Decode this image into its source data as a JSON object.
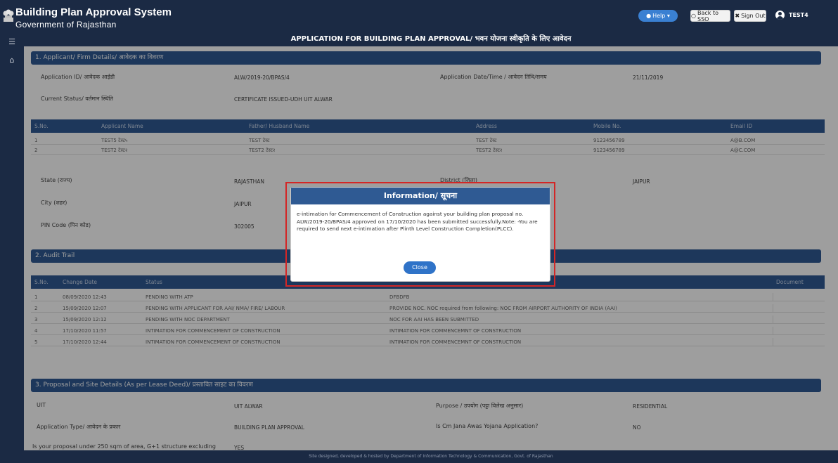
{
  "header": {
    "app_title": "Building Plan Approval System",
    "subtitle": "Government of Rajasthan",
    "help_label": "Help ▾",
    "back_sso_label": "Back to SSO",
    "sign_out_label": "Sign Out",
    "user_name": "TEST4"
  },
  "page_title": "APPLICATION FOR BUILDING PLAN APPROVAL/ भवन योजना स्वीकृति के लिए आवेदन",
  "section1": {
    "title": "1. Applicant/ Firm Details/ आवेदक का विवरण",
    "app_id_label": "Application ID/ आवेदक आईडी",
    "app_id_value": "ALW/2019-20/BPAS/4",
    "app_date_label": "Application Date/Time / आवेदन तिथि/समय",
    "app_date_value": "21/11/2019",
    "status_label": "Current Status/ वर्तमान स्थिति",
    "status_value": "CERTIFICATE ISSUED-UDH UIT ALWAR",
    "table_headers": [
      "S.No.",
      "Applicant Name",
      "Father/ Husband Name",
      "Address",
      "Mobile No.",
      "Email ID"
    ],
    "rows": [
      [
        "1",
        "TEST5 टेस्ट५",
        "TEST टेस्ट",
        "TEST टेस्ट",
        "9123456789",
        "A@B.COM"
      ],
      [
        "2",
        "TEST2 टेस्ट२",
        "TEST2 टेस्ट२",
        "TEST2 टेस्ट२",
        "9123456789",
        "A@C.COM"
      ]
    ],
    "state_label": "State (राज्य)",
    "state_value": "RAJASTHAN",
    "district_label": "District (जिला)",
    "district_value": "JAIPUR",
    "city_label": "City (शहर)",
    "city_value": "JAIPUR",
    "pin_label": "PIN Code (पिन कोड)",
    "pin_value": "302005"
  },
  "section2": {
    "title": "2. Audit Trail",
    "table_headers": [
      "S.No.",
      "Change Date",
      "Status",
      "",
      "Document"
    ],
    "rows": [
      [
        "1",
        "08/09/2020 12:43",
        "PENDING WITH ATP",
        "DFBDFB"
      ],
      [
        "2",
        "15/09/2020 12:07",
        "PENDING WITH APPLICANT FOR AAI/ NMA/ FIRE/ LABOUR",
        "PROVIDE NOC. NOC required from following: NOC FROM AIRPORT AUTHORITY OF INDIA (AAI)"
      ],
      [
        "3",
        "15/09/2020 12:12",
        "PENDING WITH NOC DEPARTMENT",
        "NOC FOR AAI HAS BEEN SUBMITTED"
      ],
      [
        "4",
        "17/10/2020 11:57",
        "INTIMATION FOR COMMENCEMENT OF CONSTRUCTION",
        "INTIMATION FOR COMMENCEMNT OF CONSTRUCTION"
      ],
      [
        "5",
        "17/10/2020 12:44",
        "INTIMATION FOR COMMENCEMENT OF CONSTRUCTION",
        "INTIMATION FOR COMMENCEMNT OF CONSTRUCTION"
      ]
    ]
  },
  "section3": {
    "title": "3. Proposal and Site Details (As per Lease Deed)/ प्रस्तावित साइट का विवरण",
    "uit_label": "UIT",
    "uit_value": "UIT ALWAR",
    "purpose_label": "Purpose / उपयोग (पट्टा विलेख अनुसार)",
    "purpose_value": "RESIDENTIAL",
    "type_label": "Application Type/ आवेदन के प्रकार",
    "type_value": "BUILDING PLAN APPROVAL",
    "cm_label": "Is Cm Jana Awas Yojana Application?",
    "cm_value": "NO",
    "small_label": "Is your proposal under 250 sqm of area, G+1 structure excluding",
    "small_value": "YES"
  },
  "footer": "Site designed, developed & hosted by Department of Information Technology & Communication, Govt. of Rajasthan",
  "modal": {
    "title": "Information/ सूचना",
    "message": "e-intimation for Commencement of Construction against your building plan proposal no. ALW/2019-20/BPAS/4 approved on 17/10/2020 has been submitted successfully.Note: -You are required to send next e-intimation after Plinth Level Construction Completion(PLCC).",
    "close_label": "Close"
  },
  "colors": {
    "navy": "#1b2a44",
    "section_blue": "#2f5a93",
    "highlight_red": "#d32626",
    "button_blue": "#2f73c8"
  }
}
